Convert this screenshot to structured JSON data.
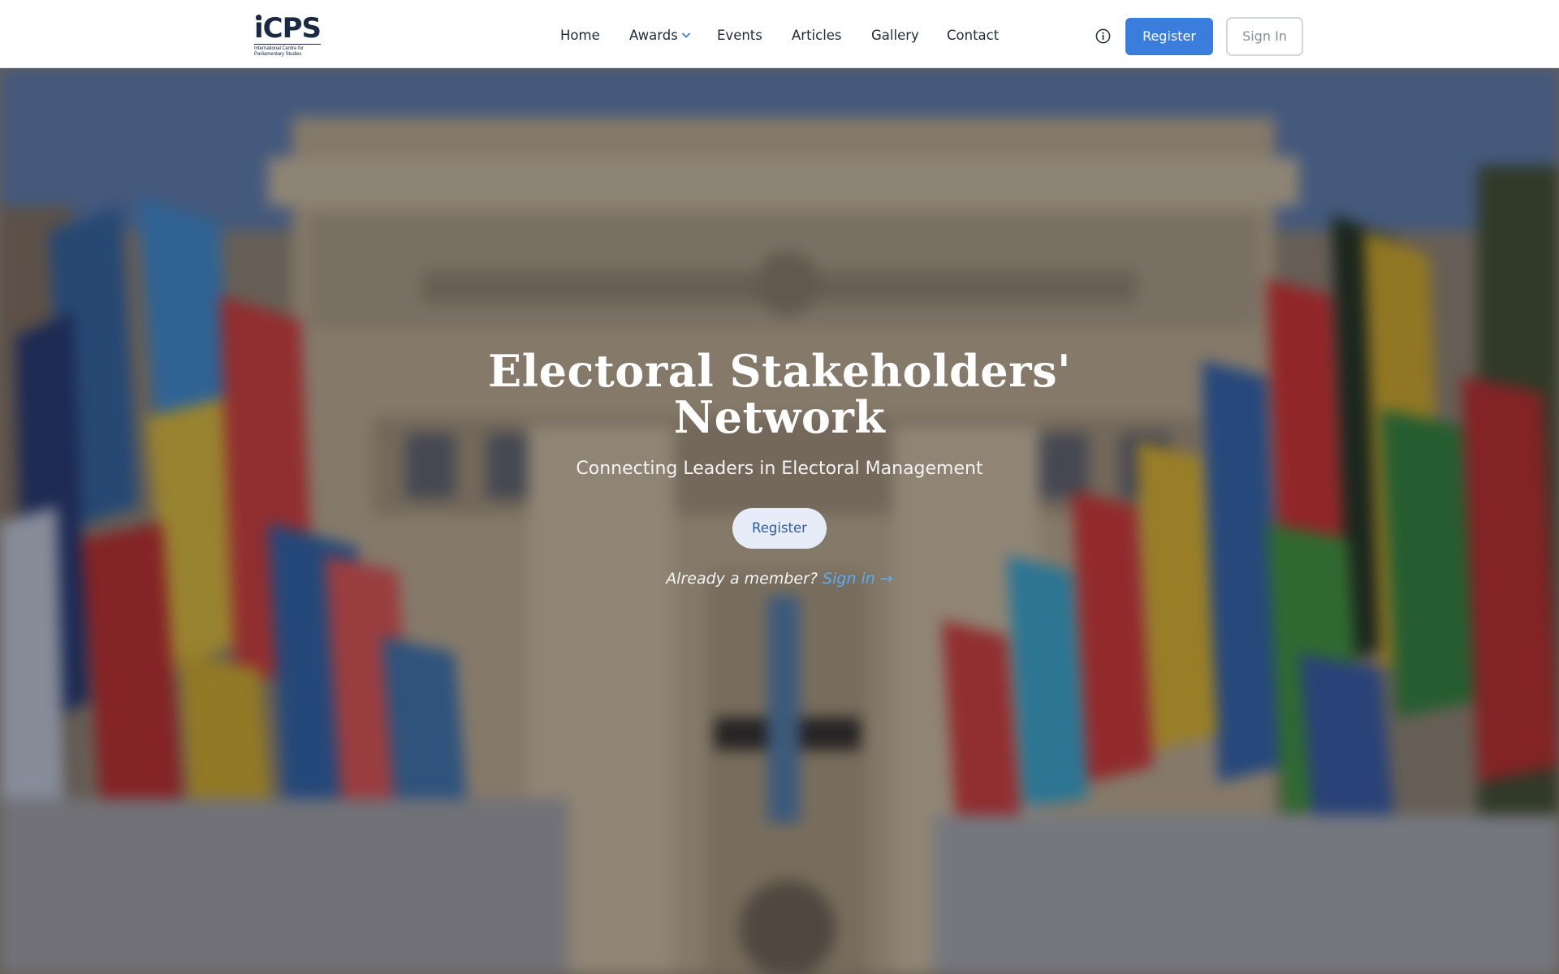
{
  "brand": {
    "logo_text": "iCPS",
    "logo_subtext": "International Centre for Parliamentary Studies"
  },
  "nav": {
    "items": [
      {
        "label": "Home"
      },
      {
        "label": "Awards",
        "icon": "chevron-down-icon"
      },
      {
        "label": "Events"
      },
      {
        "label": "Articles"
      },
      {
        "label": "Gallery"
      },
      {
        "label": "Contact"
      }
    ]
  },
  "header_actions": {
    "info_icon": "info-icon",
    "register_label": "Register",
    "signin_label": "Sign In",
    "register_color": "#3b7ddd"
  },
  "hero": {
    "title": "Electoral Stakeholders' Network",
    "subtitle": "Connecting Leaders in Electoral Management",
    "register_label": "Register",
    "member_prompt": "Already a member?",
    "signin_link": "Sign in →",
    "link_color": "#5aaef0"
  }
}
